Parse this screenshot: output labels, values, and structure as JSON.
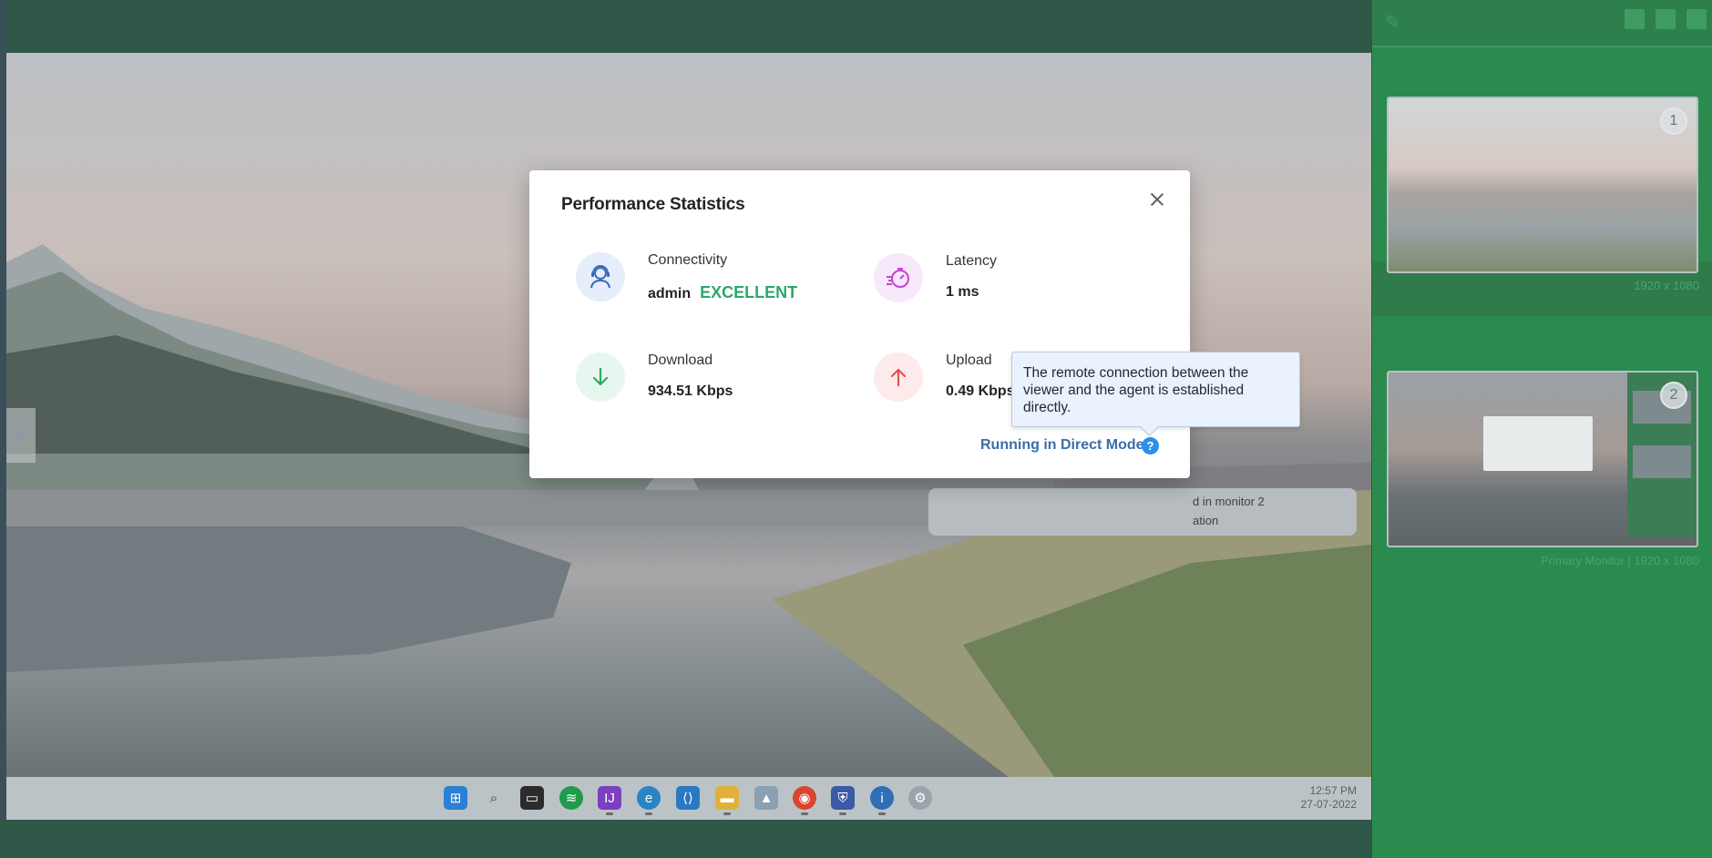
{
  "background_window": {
    "taskbar": {
      "clock_time": "12:57 PM",
      "clock_date": "27-07-2022",
      "apps": [
        "windows-start",
        "search",
        "terminal",
        "spotify",
        "intellij",
        "edge",
        "vscode",
        "file-explorer",
        "photos",
        "chrome",
        "defender",
        "agent",
        "settings"
      ]
    },
    "notification": {
      "line1": "d in monitor 2",
      "line2": "ation"
    }
  },
  "monitors_panel": {
    "monitors": [
      {
        "number": "1",
        "caption": "1920 x 1080"
      },
      {
        "number": "2",
        "caption": "Primary Monitor | 1920 x 1080"
      }
    ]
  },
  "dialog": {
    "title": "Performance Statistics",
    "stats": {
      "connectivity": {
        "label": "Connectivity",
        "user": "admin",
        "quality": "EXCELLENT"
      },
      "latency": {
        "label": "Latency",
        "value": "1 ms"
      },
      "download": {
        "label": "Download",
        "value": "934.51 Kbps"
      },
      "upload": {
        "label": "Upload",
        "value": "0.49 Kbps"
      }
    },
    "mode_text": "Running in Direct Mode",
    "help_icon_glyph": "?",
    "tooltip": "The remote connection between the viewer and the agent is established directly."
  },
  "colors": {
    "quality_good": "#2ea868",
    "mode_link": "#3a6ea8",
    "help_icon": "#2c8fe8",
    "panel_green": "#2b8a4e"
  }
}
